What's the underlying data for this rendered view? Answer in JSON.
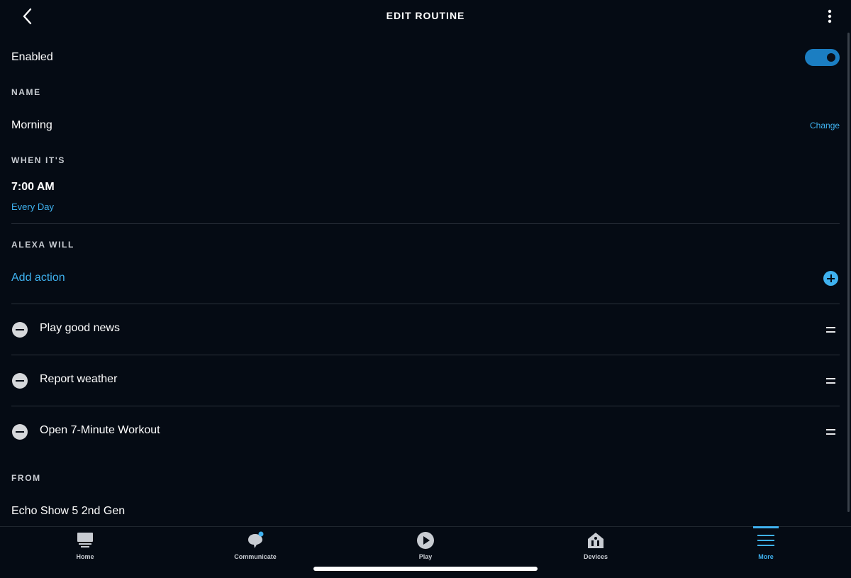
{
  "header": {
    "title": "EDIT ROUTINE",
    "back_icon": "chevron-left-icon",
    "menu_icon": "kebab-menu-icon"
  },
  "enabled": {
    "label": "Enabled",
    "toggle_on": true
  },
  "name": {
    "section_label": "NAME",
    "value": "Morning",
    "change_label": "Change"
  },
  "when": {
    "section_label": "WHEN IT'S",
    "time": "7:00 AM",
    "recurrence": "Every Day"
  },
  "alexa_will": {
    "section_label": "ALEXA WILL",
    "add_action_label": "Add action",
    "actions": [
      {
        "label": "Play good news"
      },
      {
        "label": "Report weather"
      },
      {
        "label": "Open 7-Minute Workout"
      }
    ]
  },
  "from": {
    "section_label": "FROM",
    "device": "Echo Show 5 2nd Gen"
  },
  "tabbar": {
    "tabs": [
      {
        "label": "Home",
        "icon": "home-icon",
        "active": false
      },
      {
        "label": "Communicate",
        "icon": "chat-bubble-icon",
        "active": false,
        "badge": true
      },
      {
        "label": "Play",
        "icon": "play-icon",
        "active": false
      },
      {
        "label": "Devices",
        "icon": "devices-icon",
        "active": false
      },
      {
        "label": "More",
        "icon": "menu-icon",
        "active": true
      }
    ]
  },
  "colors": {
    "background": "#050b14",
    "accent": "#3fb2f0",
    "toggle": "#1b7ec2",
    "divider": "#2a313b"
  }
}
